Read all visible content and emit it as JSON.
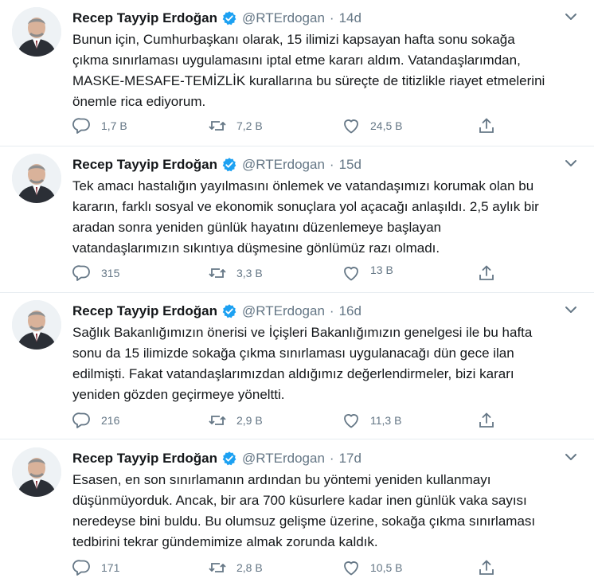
{
  "author": {
    "name": "Recep Tayyip Erdoğan",
    "handle": "@RTErdogan"
  },
  "tweets": [
    {
      "time": "14d",
      "lines": [
        "Bunun için, Cumhurbaşkanı olarak, 15 ilimizi kapsayan hafta sonu sokağa",
        "çıkma sınırlaması uygulamasını iptal etme kararı aldım. Vatandaşlarımdan,",
        "MASKE-MESAFE-TEMİZLİK kurallarına bu süreçte de titizlikle riayet etmelerini",
        "önemle rica ediyorum."
      ],
      "replies": "1,7 B",
      "retweets": "7,2 B",
      "likes": "24,5 B"
    },
    {
      "time": "15d",
      "lines": [
        "Tek amacı hastalığın yayılmasını önlemek ve vatandaşımızı korumak olan bu",
        "kararın, farklı sosyal ve ekonomik sonuçlara yol açacağı anlaşıldı. 2,5 aylık bir",
        "aradan sonra yeniden günlük hayatını düzenlemeye başlayan",
        "vatandaşlarımızın sıkıntıya düşmesine gönlümüz razı olmadı."
      ],
      "replies": "315",
      "retweets": "3,3 B",
      "likes": "13 B"
    },
    {
      "time": "16d",
      "lines": [
        "Sağlık Bakanlığımızın önerisi ve İçişleri Bakanlığımızın genelgesi ile bu hafta",
        "sonu da 15 ilimizde sokağa çıkma sınırlaması uygulanacağı dün gece ilan",
        "edilmişti. Fakat vatandaşlarımızdan aldığımız değerlendirmeler, bizi kararı",
        "yeniden gözden geçirmeye yöneltti."
      ],
      "replies": "216",
      "retweets": "2,9 B",
      "likes": "11,3 B"
    },
    {
      "time": "17d",
      "lines": [
        "Esasen, en son sınırlamanın ardından bu yöntemi yeniden kullanmayı",
        "düşünmüyorduk. Ancak, bir ara 700 küsurlere kadar inen günlük vaka sayısı",
        "neredeyse bini buldu. Bu olumsuz gelişme üzerine, sokağa çıkma sınırlaması",
        "tedbirini tekrar gündemimize almak zorunda kaldık."
      ],
      "replies": "171",
      "retweets": "2,8 B",
      "likes": "10,5 B"
    }
  ],
  "icons": {
    "verified": "verified-badge-icon",
    "caret": "chevron-down-icon",
    "reply": "reply-icon",
    "retweet": "retweet-icon",
    "like": "heart-icon",
    "share": "share-icon"
  },
  "colors": {
    "accent": "#1da1f2",
    "secondary_text": "#657786",
    "divider": "#e6ecf0"
  }
}
